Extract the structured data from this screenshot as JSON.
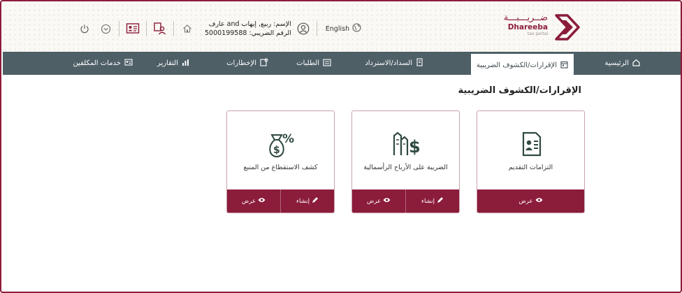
{
  "header": {
    "logo": {
      "arabic": "ضــريـــبـــة",
      "english": "Dhareeba",
      "subtitle": "tax portal"
    },
    "language": "English",
    "user": {
      "name": "الإسم: ربيع, إيهاب and عارف",
      "tax_number": "الرقم الضريبي: 5000199588"
    },
    "icons": [
      "power-icon",
      "chevron-circle-icon",
      "id-card-icon",
      "user-switch-icon",
      "home-icon",
      "user-circle-icon",
      "globe-icon"
    ]
  },
  "nav": {
    "items": [
      {
        "label": "الرئيسية",
        "icon": "home-icon"
      },
      {
        "label": "الإقرارات/الكشوف الضريبية",
        "icon": "calendar-icon",
        "active": true
      },
      {
        "label": "السداد/الاسترداد",
        "icon": "payment-icon"
      },
      {
        "label": "الطلبات",
        "icon": "requests-icon"
      },
      {
        "label": "الإخطارات",
        "icon": "notifications-icon"
      },
      {
        "label": "التقارير",
        "icon": "bar-chart-icon"
      },
      {
        "label": "خدمات المكلفين",
        "icon": "taxpayer-services-icon"
      }
    ]
  },
  "main": {
    "title": "الإقرارات/الكشوف الضريبية",
    "cards": [
      {
        "title": "التزامات التقديم",
        "icon": "filing-document-icon",
        "view_label": "عرض"
      },
      {
        "title": "الضريبة على الأرباح الرأسمالية",
        "icon": "capital-gains-icon",
        "create_label": "إنشاء",
        "view_label": "عرض"
      },
      {
        "title": "كشف الاستقطاع من المنبع",
        "icon": "money-bag-percent-icon",
        "create_label": "إنشاء",
        "view_label": "عرض"
      }
    ]
  },
  "colors": {
    "brand": "#8b1c3a",
    "nav_bg": "#4e5f66",
    "header_bg": "#fbf9f5"
  }
}
